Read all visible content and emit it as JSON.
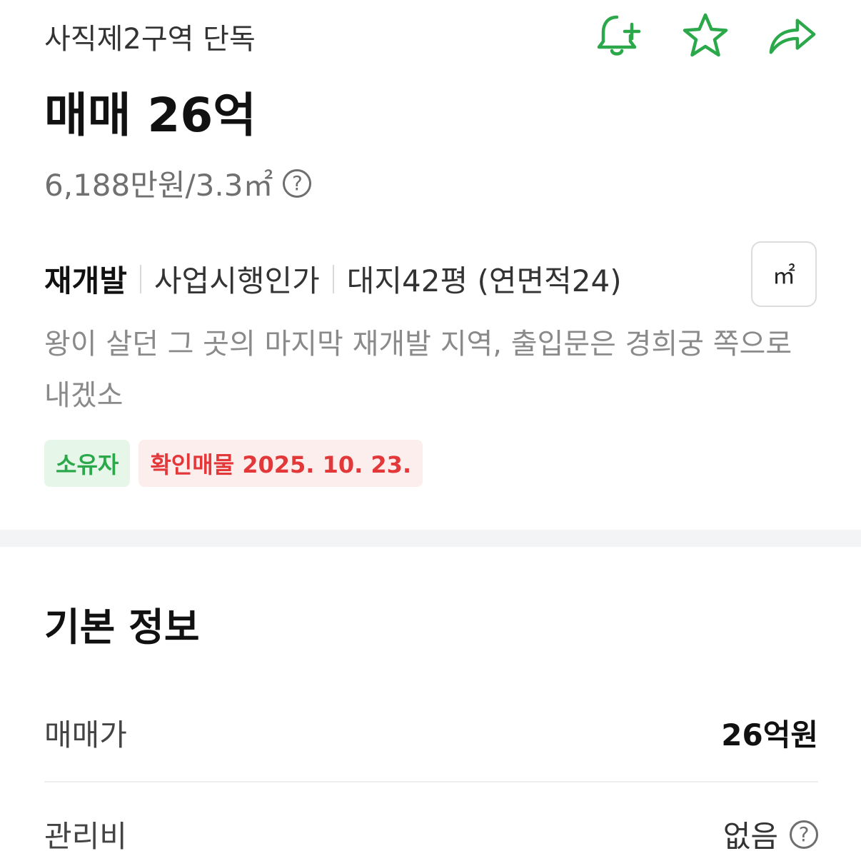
{
  "listing": {
    "complex_name": "사직제2구역 단독",
    "price_title": "매매 26억",
    "unit_price": "6,188만원/3.3㎡",
    "unit_price_help": "?",
    "tags": {
      "type": "재개발",
      "stage": "사업시행인가",
      "area": "대지42평 (연면적24)"
    },
    "unit_toggle_label": "㎡",
    "description": "왕이 살던 그 곳의 마지막 재개발 지역, 출입문은 경희궁 쪽으로 내겠소",
    "badges": {
      "owner": "소유자",
      "verified": "확인매물 2025. 10. 23."
    }
  },
  "actions": {
    "icons": [
      "bell-plus-icon",
      "star-icon",
      "share-arrow-icon"
    ],
    "accent_color": "#2aa84a"
  },
  "basic_info": {
    "title": "기본 정보",
    "rows": [
      {
        "label": "매매가",
        "value": "26억원"
      },
      {
        "label": "관리비",
        "value": "없음",
        "help": "?"
      }
    ]
  },
  "colors": {
    "owner_badge_bg": "#e6f7ea",
    "owner_badge_text": "#2aa84a",
    "verified_badge_bg": "#fdeeee",
    "verified_badge_text": "#e2383a"
  }
}
